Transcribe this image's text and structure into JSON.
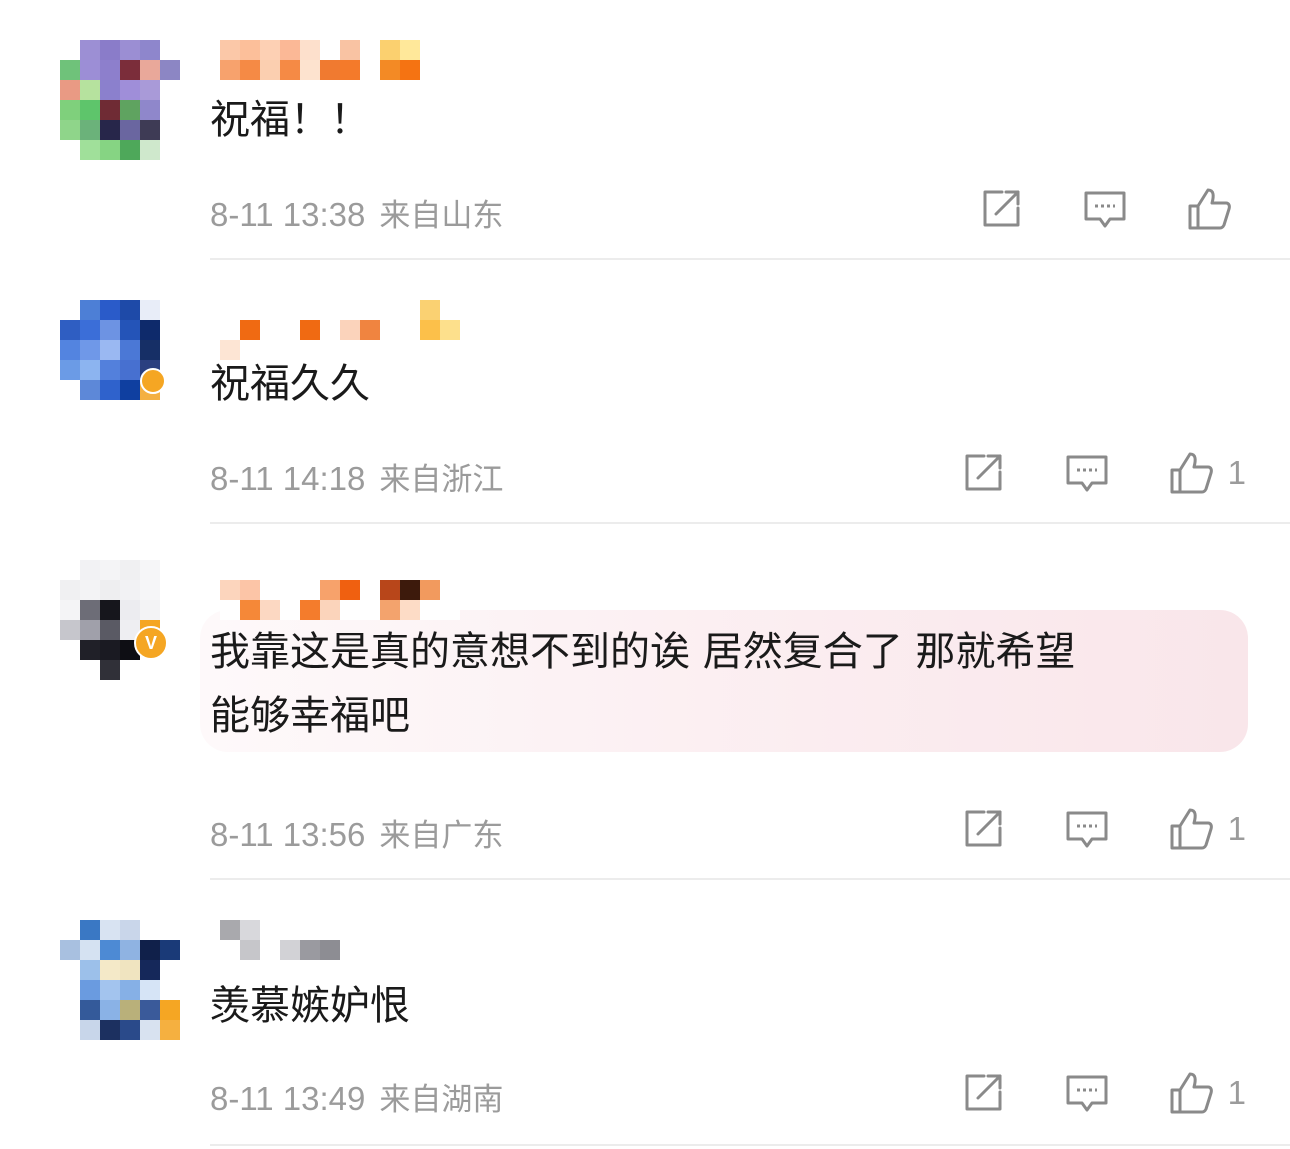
{
  "comments": [
    {
      "text": "祝福！！",
      "time": "8-11 13:38",
      "location": "来自山东",
      "likes": ""
    },
    {
      "text": "祝福久久",
      "time": "8-11 14:18",
      "location": "来自浙江",
      "likes": "1"
    },
    {
      "text_line1": "我靠这是真的意想不到的诶 居然复合了 那就希望",
      "text_line2": "能够幸福吧",
      "time": "8-11 13:56",
      "location": "来自广东",
      "likes": "1"
    },
    {
      "text": "羡慕嫉妒恨",
      "time": "8-11 13:49",
      "location": "来自湖南",
      "likes": "1"
    }
  ],
  "icons": [
    "share-icon",
    "reply-icon",
    "like-icon",
    "verified-badge-icon"
  ],
  "colors": {
    "text": "#1a1a1a",
    "meta": "#9b9b9b",
    "badge": "#f5a623",
    "highlight": "#f9e6ea"
  }
}
